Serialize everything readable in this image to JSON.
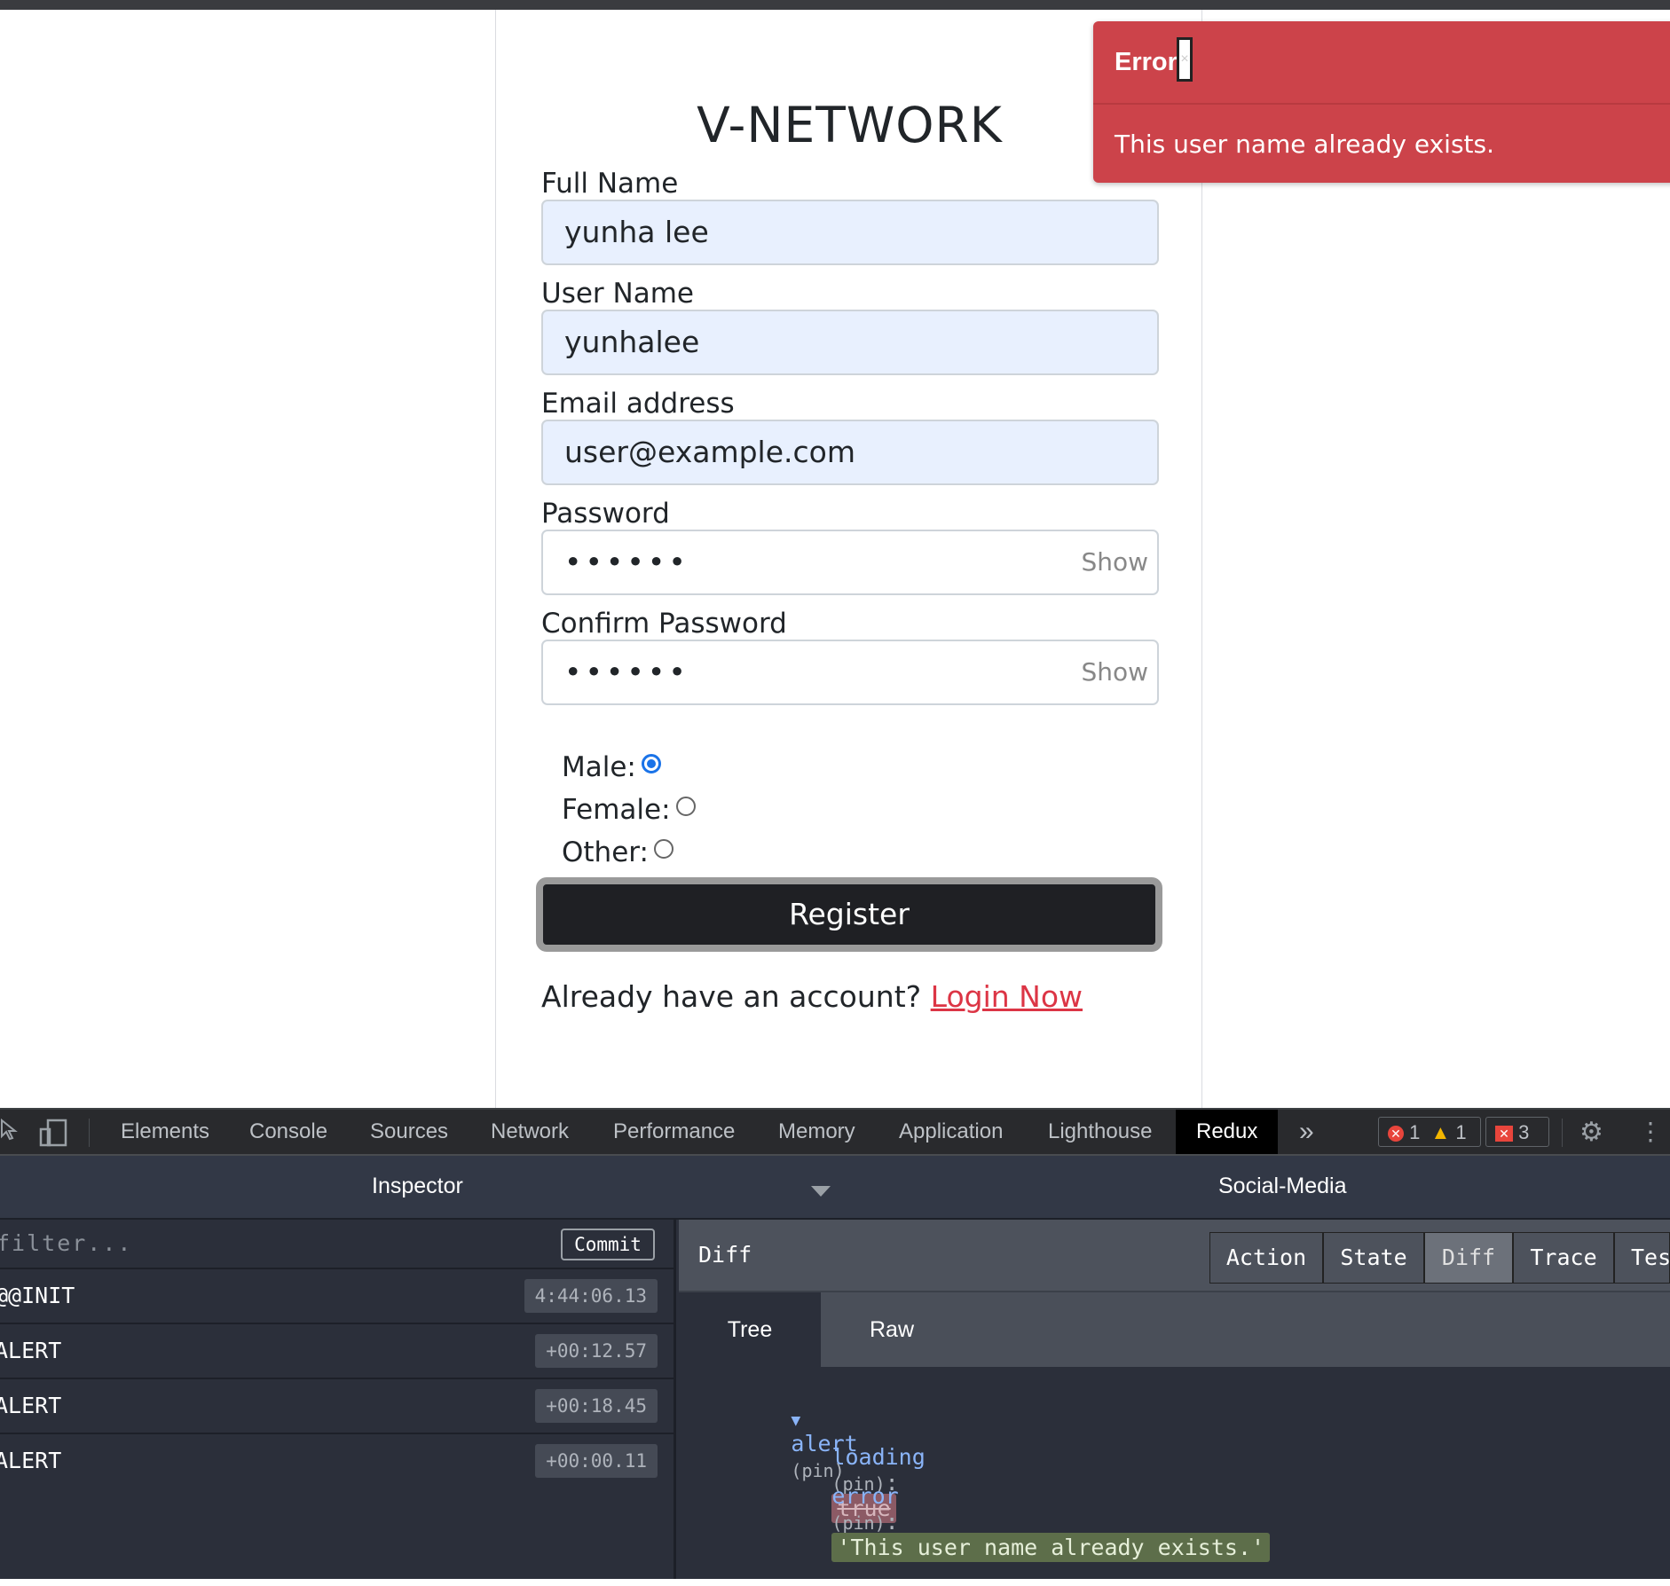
{
  "app": {
    "brand": "V-NETWORK"
  },
  "form": {
    "fullname_label": "Full Name",
    "fullname_value": "yunha lee",
    "username_label": "User Name",
    "username_value": "yunhalee",
    "email_label": "Email address",
    "email_value": "user@example.com",
    "password_label": "Password",
    "password_value": "••••••",
    "password_show": "Show",
    "confirm_label": "Confirm Password",
    "confirm_value": "••••••",
    "confirm_show": "Show",
    "gender_male": "Male:",
    "gender_female": "Female:",
    "gender_other": "Other:",
    "gender_selected": "male",
    "register_label": "Register",
    "already_text": "Already have an account?",
    "login_link": "Login Now"
  },
  "toast": {
    "title": "Error",
    "close": "×",
    "message": "This user name already exists."
  },
  "devtools": {
    "tabs": [
      "Elements",
      "Console",
      "Sources",
      "Network",
      "Performance",
      "Memory",
      "Application",
      "Lighthouse",
      "Redux"
    ],
    "active_tab": "Redux",
    "more": "»",
    "errors_count": "1",
    "warnings_count": "1",
    "issues_count": "3",
    "inspector_title": "Inspector",
    "store_name": "Social-Media",
    "filter_placeholder": "filter...",
    "commit_label": "Commit",
    "actions": [
      {
        "name": "@@INIT",
        "time": "4:44:06.13"
      },
      {
        "name": "ALERT",
        "time": "+00:12.57"
      },
      {
        "name": "ALERT",
        "time": "+00:18.45"
      },
      {
        "name": "ALERT",
        "time": "+00:00.11"
      }
    ],
    "diff_label": "Diff",
    "monitor_tabs": [
      "Action",
      "State",
      "Diff",
      "Trace",
      "Tes"
    ],
    "active_monitor_tab": "Diff",
    "view_tabs": [
      "Tree",
      "Raw"
    ],
    "active_view_tab": "Tree",
    "tree": {
      "root_key": "alert",
      "pin": "(pin)",
      "loading_key": "loading",
      "loading_old": "true",
      "error_key": "error",
      "error_new": "'This user name already exists.'"
    }
  },
  "colors": {
    "toast_bg": "#cc434a",
    "link": "#dc3545",
    "register_bg": "#1f2024",
    "input_autofill": "#e8f0fe",
    "devtools_bg": "#2b2f3a"
  }
}
